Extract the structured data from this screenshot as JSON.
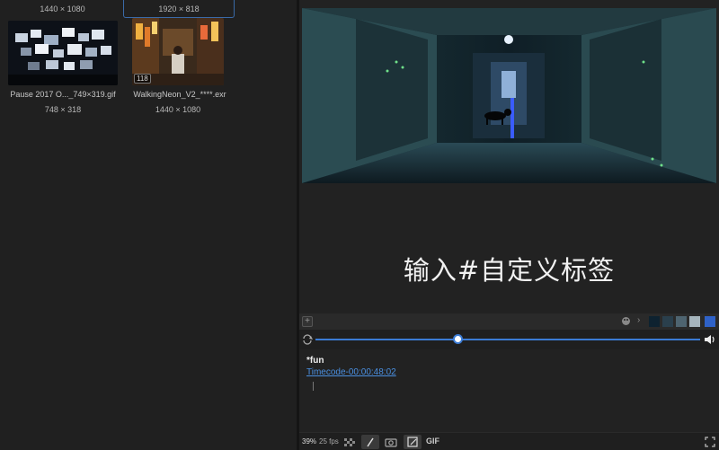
{
  "grid": {
    "top_row": [
      {
        "dimensions": "1440 × 1080"
      },
      {
        "dimensions": "1920 × 818",
        "selected": true
      }
    ],
    "items": [
      {
        "filename": "Pause 2017 O..._749×319.gif",
        "dimensions": "748 × 318",
        "icon": "tv-wall-thumbnail"
      },
      {
        "filename": "WalkingNeon_V2_****.exr",
        "dimensions": "1440 × 1080",
        "badge": "118",
        "icon": "neon-street-thumbnail"
      }
    ]
  },
  "preview": {
    "tag_text": "输入#自定义标签"
  },
  "toolbar": {
    "add_label": "+",
    "swatches": [
      "#0e2230",
      "#2a3f4c",
      "#4e6470",
      "#a6b5bd",
      "#2f62c8"
    ]
  },
  "timeline": {
    "progress": 0.37
  },
  "notes": {
    "title": "*fun",
    "link": "Timecode-00:00:48:02"
  },
  "bottom": {
    "zoom": "39%",
    "fps": "25 fps",
    "gif_label": "GIF"
  },
  "colors": {
    "accent": "#3b7bd4",
    "background": "#1e1e1e"
  }
}
